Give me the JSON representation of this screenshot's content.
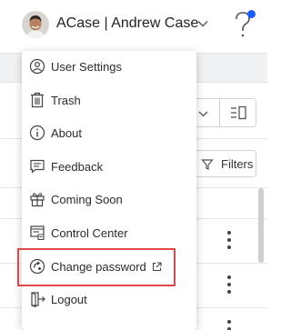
{
  "header": {
    "user_label": "ACase | Andrew Case",
    "avatar": "user-avatar",
    "dropdown_icon": "chevron-down-icon",
    "help_icon": "question-mark-icon",
    "notification_color": "#1b5cff"
  },
  "menu": {
    "items": [
      {
        "label": "User Settings",
        "icon": "user-settings-icon"
      },
      {
        "label": "Trash",
        "icon": "trash-icon"
      },
      {
        "label": "About",
        "icon": "info-icon"
      },
      {
        "label": "Feedback",
        "icon": "feedback-icon"
      },
      {
        "label": "Coming Soon",
        "icon": "gift-icon"
      },
      {
        "label": "Control Center",
        "icon": "control-center-icon"
      },
      {
        "label": "Change password",
        "icon": "change-password-icon",
        "external": true
      },
      {
        "label": "Logout",
        "icon": "logout-icon"
      }
    ],
    "highlight_color": "#e0474a"
  },
  "background": {
    "filters_label": "Filters"
  }
}
